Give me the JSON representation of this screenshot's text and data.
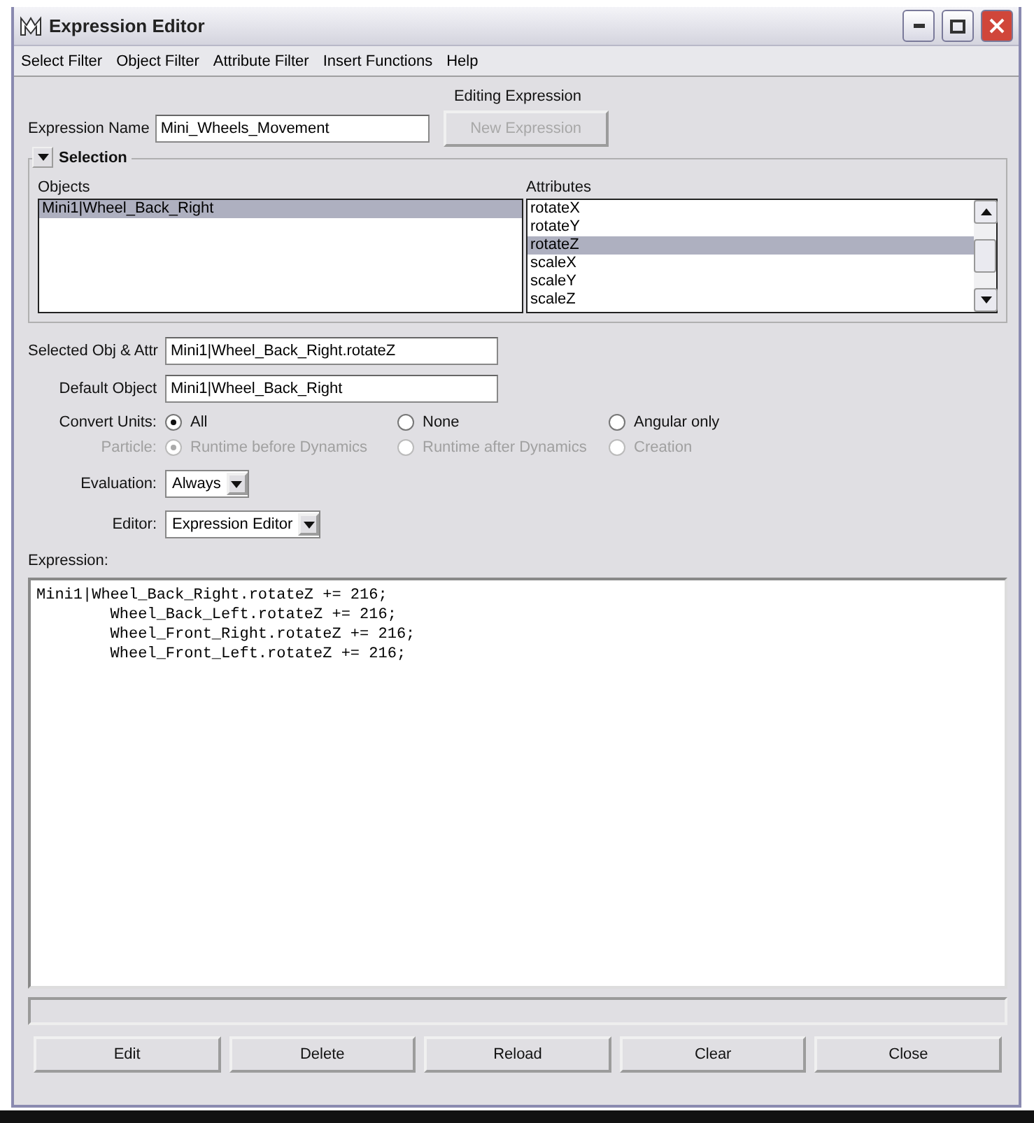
{
  "window": {
    "title": "Expression Editor"
  },
  "menu": [
    "Select Filter",
    "Object Filter",
    "Attribute Filter",
    "Insert Functions",
    "Help"
  ],
  "heading": "Editing Expression",
  "expression_name": {
    "label": "Expression Name",
    "value": "Mini_Wheels_Movement"
  },
  "new_expression_button": {
    "label": "New Expression",
    "disabled": true
  },
  "selection": {
    "title": "Selection",
    "expanded": true,
    "objects": {
      "label": "Objects",
      "items": [
        {
          "label": "Mini1|Wheel_Back_Right",
          "selected": true
        }
      ]
    },
    "attributes": {
      "label": "Attributes",
      "items": [
        {
          "label": "rotateX",
          "selected": false
        },
        {
          "label": "rotateY",
          "selected": false
        },
        {
          "label": "rotateZ",
          "selected": true
        },
        {
          "label": "scaleX",
          "selected": false
        },
        {
          "label": "scaleY",
          "selected": false
        },
        {
          "label": "scaleZ",
          "selected": false
        }
      ]
    }
  },
  "selected_obj_attr": {
    "label": "Selected Obj & Attr",
    "value": "Mini1|Wheel_Back_Right.rotateZ"
  },
  "default_object": {
    "label": "Default Object",
    "value": "Mini1|Wheel_Back_Right"
  },
  "radio_groups": [
    {
      "label": "Convert Units:",
      "disabled": false,
      "options": [
        {
          "label": "All",
          "selected": true
        },
        {
          "label": "None",
          "selected": false
        },
        {
          "label": "Angular only",
          "selected": false
        }
      ]
    },
    {
      "label": "Particle:",
      "disabled": true,
      "options": [
        {
          "label": "Runtime before Dynamics",
          "selected": true
        },
        {
          "label": "Runtime after Dynamics",
          "selected": false
        },
        {
          "label": "Creation",
          "selected": false
        }
      ]
    }
  ],
  "dropdowns": [
    {
      "label": "Evaluation:",
      "value": "Always"
    },
    {
      "label": "Editor:",
      "value": "Expression Editor"
    }
  ],
  "expression": {
    "label": "Expression:",
    "lines": [
      "Mini1|Wheel_Back_Right.rotateZ += 216;",
      "        Wheel_Back_Left.rotateZ += 216;",
      "        Wheel_Front_Right.rotateZ += 216;",
      "        Wheel_Front_Left.rotateZ += 216;"
    ]
  },
  "buttons": [
    "Edit",
    "Delete",
    "Reload",
    "Clear",
    "Close"
  ]
}
